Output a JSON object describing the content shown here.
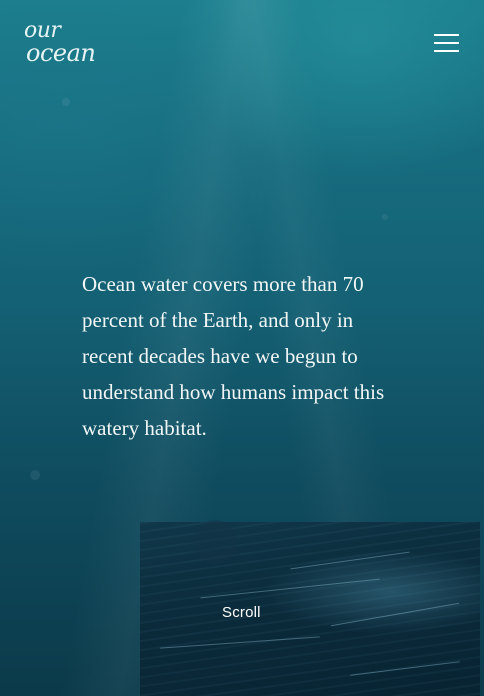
{
  "brand": {
    "logo_line1": "our",
    "logo_line2": "ocean"
  },
  "header": {
    "menu_icon": "hamburger-menu-icon"
  },
  "hero": {
    "intro": "Ocean water covers more than 70 percent of the Earth, and only in recent decades have we begun to understand how humans impact this watery habitat."
  },
  "scroll": {
    "label": "Scroll"
  },
  "colors": {
    "text": "#f2f7f6",
    "sea_top": "#1c7f8e",
    "sea_bottom": "#0b3a4a",
    "card": "#0b2c3c"
  }
}
